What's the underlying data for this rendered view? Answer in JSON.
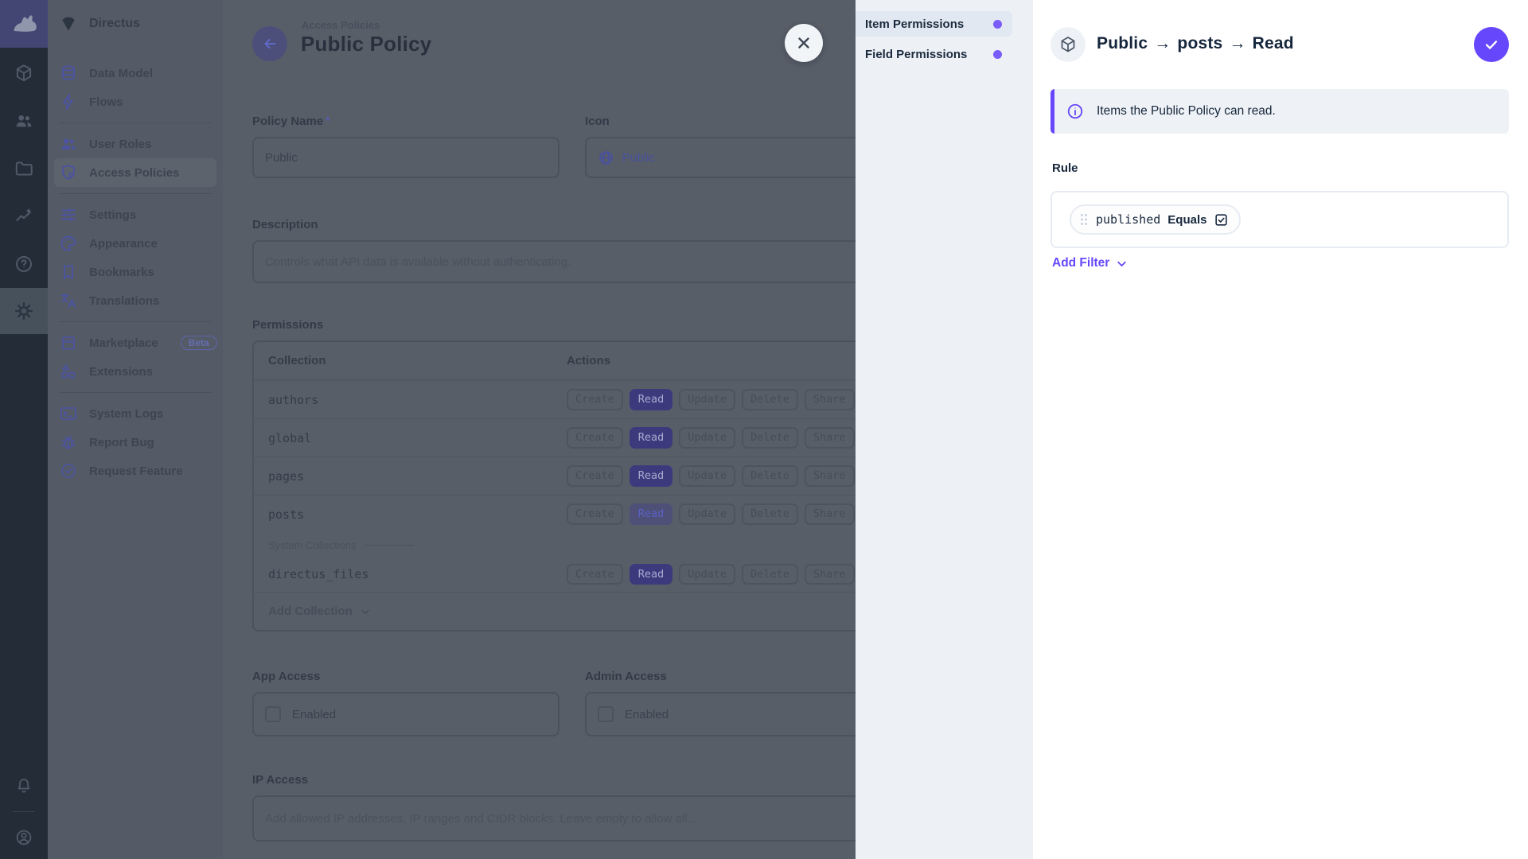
{
  "palette": {
    "accent": "#6644ff",
    "save_button": "#6747fb",
    "tab_dot": "#7a5cfa"
  },
  "nav": {
    "project_name": "Directus",
    "groups": [
      {
        "items": [
          {
            "label": "Data Model"
          },
          {
            "label": "Flows"
          }
        ]
      },
      {
        "items": [
          {
            "label": "User Roles"
          },
          {
            "label": "Access Policies",
            "active": true
          }
        ]
      },
      {
        "items": [
          {
            "label": "Settings"
          },
          {
            "label": "Appearance"
          },
          {
            "label": "Bookmarks"
          },
          {
            "label": "Translations"
          }
        ]
      },
      {
        "items": [
          {
            "label": "Marketplace",
            "badge": "Beta"
          },
          {
            "label": "Extensions"
          }
        ]
      },
      {
        "items": [
          {
            "label": "System Logs"
          },
          {
            "label": "Report Bug"
          },
          {
            "label": "Request Feature"
          }
        ]
      }
    ]
  },
  "page": {
    "breadcrumb": "Access Policies",
    "title": "Public Policy",
    "fields": {
      "policy_name": {
        "label": "Policy Name",
        "required_marker": "*",
        "value": "Public"
      },
      "icon": {
        "label": "Icon",
        "value": "Public"
      },
      "description": {
        "label": "Description",
        "value": "Controls what API data is available without authenticating."
      },
      "app_access": {
        "label": "App Access",
        "checkbox_label": "Enabled",
        "checked": false
      },
      "admin_access": {
        "label": "Admin Access",
        "checkbox_label": "Enabled",
        "checked": false
      },
      "ip_access": {
        "label": "IP Access",
        "placeholder": "Add allowed IP addresses, IP ranges and CIDR blocks. Leave empty to allow all..."
      }
    },
    "permissions": {
      "label": "Permissions",
      "columns": {
        "collection": "Collection",
        "actions": "Actions"
      },
      "actions": [
        "Create",
        "Read",
        "Update",
        "Delete",
        "Share"
      ],
      "system_group_label": "System Collections",
      "add_collection_label": "Add Collection",
      "rows": [
        {
          "collection": "authors",
          "read_state": "full"
        },
        {
          "collection": "global",
          "read_state": "full"
        },
        {
          "collection": "pages",
          "read_state": "full"
        },
        {
          "collection": "posts",
          "read_state": "editing"
        },
        {
          "collection": "directus_files",
          "group": "System Collections",
          "read_state": "full"
        }
      ]
    }
  },
  "drawer": {
    "tabs": [
      {
        "label": "Item Permissions",
        "active": true
      },
      {
        "label": "Field Permissions",
        "active": false
      }
    ],
    "title": {
      "part1": "Public",
      "part2": "posts",
      "part3": "Read",
      "separator": "→"
    },
    "notice": "Items the Public Policy can read.",
    "rule": {
      "label": "Rule",
      "filter": {
        "field": "published",
        "operator": "Equals",
        "value_checked": true
      },
      "add_filter_label": "Add Filter"
    }
  }
}
